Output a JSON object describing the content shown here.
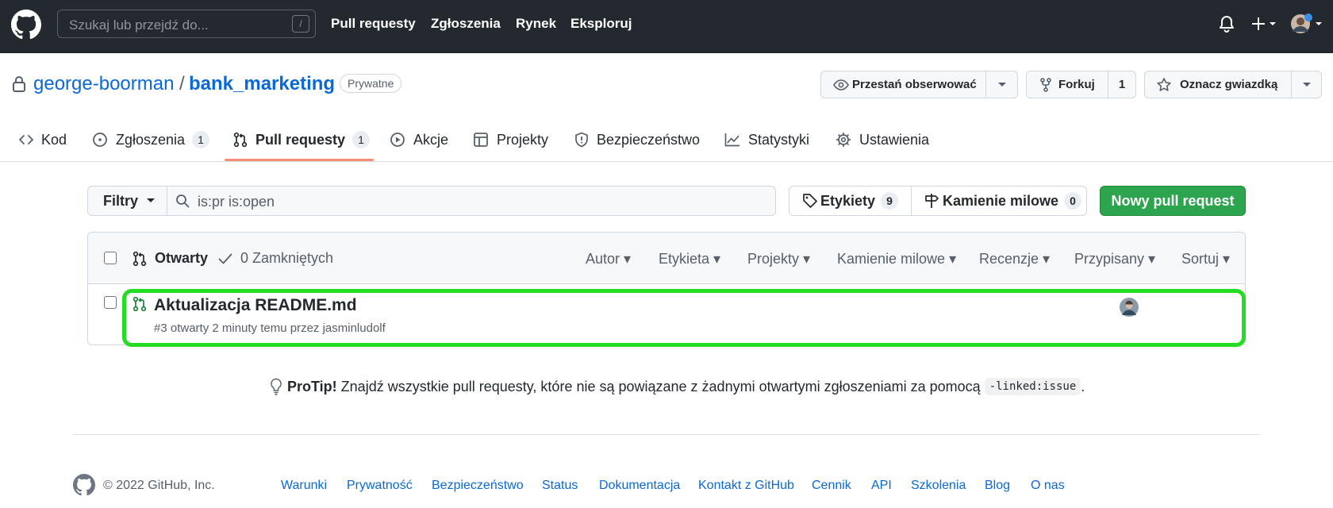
{
  "header": {
    "search_placeholder": "Szukaj lub przejdź do...",
    "search_key": "/",
    "nav": [
      "Pull requesty",
      "Zgłoszenia",
      "Rynek",
      "Eksploruj"
    ]
  },
  "repo": {
    "owner": "george-boorman",
    "separator": "/",
    "name": "bank_marketing",
    "visibility": "Prywatne",
    "watch_label": "Przestań obserwować",
    "fork_label": "Forkuj",
    "fork_count": "1",
    "star_label": "Oznacz gwiazdką"
  },
  "tabs": [
    {
      "label": "Kod",
      "icon": "code-icon"
    },
    {
      "label": "Zgłoszenia",
      "icon": "issue-opened-icon",
      "count": "1"
    },
    {
      "label": "Pull requesty",
      "icon": "git-pull-request-icon",
      "count": "1",
      "selected": true
    },
    {
      "label": "Akcje",
      "icon": "play-icon"
    },
    {
      "label": "Projekty",
      "icon": "table-icon"
    },
    {
      "label": "Bezpieczeństwo",
      "icon": "shield-icon"
    },
    {
      "label": "Statystyki",
      "icon": "graph-icon"
    },
    {
      "label": "Ustawienia",
      "icon": "gear-icon"
    }
  ],
  "filterbar": {
    "filters_label": "Filtry",
    "query": "is:pr is:open",
    "labels_label": "Etykiety",
    "labels_count": "9",
    "milestones_label": "Kamienie milowe",
    "milestones_count": "0",
    "new_pr_label": "Nowy pull request"
  },
  "list": {
    "open_label": "Otwarty",
    "closed_label": "0 Zamkniętych",
    "sorts": [
      "Autor",
      "Etykieta",
      "Projekty",
      "Kamienie milowe",
      "Recenzje",
      "Przypisany",
      "Sortuj"
    ],
    "items": [
      {
        "title": "Aktualizacja README.md",
        "meta": "#3 otwarty 2 minuty temu przez jasminludolf"
      }
    ]
  },
  "protip": {
    "bold": "ProTip!",
    "text": "Znajdź wszystkie pull requesty, które nie są powiązane z żadnymi otwartymi zgłoszeniami za pomocą",
    "code": "-linked:issue",
    "end": "."
  },
  "footer": {
    "copyright": "© 2022 GitHub, Inc.",
    "links": [
      "Warunki",
      "Prywatność",
      "Bezpieczeństwo",
      "Status",
      "Dokumentacja",
      "Kontakt z GitHub",
      "Cennik",
      "API",
      "Szkolenia",
      "Blog",
      "O nas"
    ]
  },
  "colors": {
    "header_bg": "#24292f",
    "link": "#0969da",
    "primary_button": "#2da44e",
    "tab_underline": "#fd8c73",
    "highlight": "#22dd22",
    "open_icon": "#1a7f37"
  }
}
